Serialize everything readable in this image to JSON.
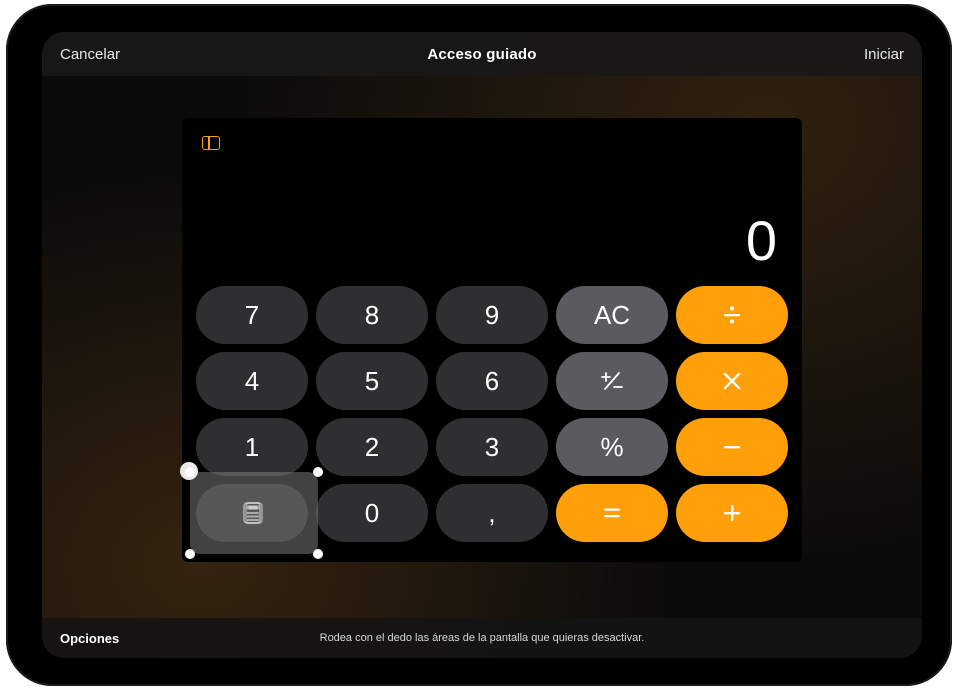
{
  "nav": {
    "cancel": "Cancelar",
    "title": "Acceso guiado",
    "start": "Iniciar"
  },
  "toolbar": {
    "options": "Opciones",
    "hint": "Rodea con el dedo las áreas de la pantalla que quieras desactivar."
  },
  "calculator": {
    "display": "0",
    "keys": {
      "k7": "7",
      "k8": "8",
      "k9": "9",
      "ac": "AC",
      "k4": "4",
      "k5": "5",
      "k6": "6",
      "k1": "1",
      "k2": "2",
      "k3": "3",
      "percent": "%",
      "k0": "0",
      "decimal": ","
    }
  },
  "region": {
    "close_glyph": "×"
  },
  "colors": {
    "operator": "#ff9f0a",
    "function": "#5b5b5f",
    "number": "#2f2f31"
  }
}
